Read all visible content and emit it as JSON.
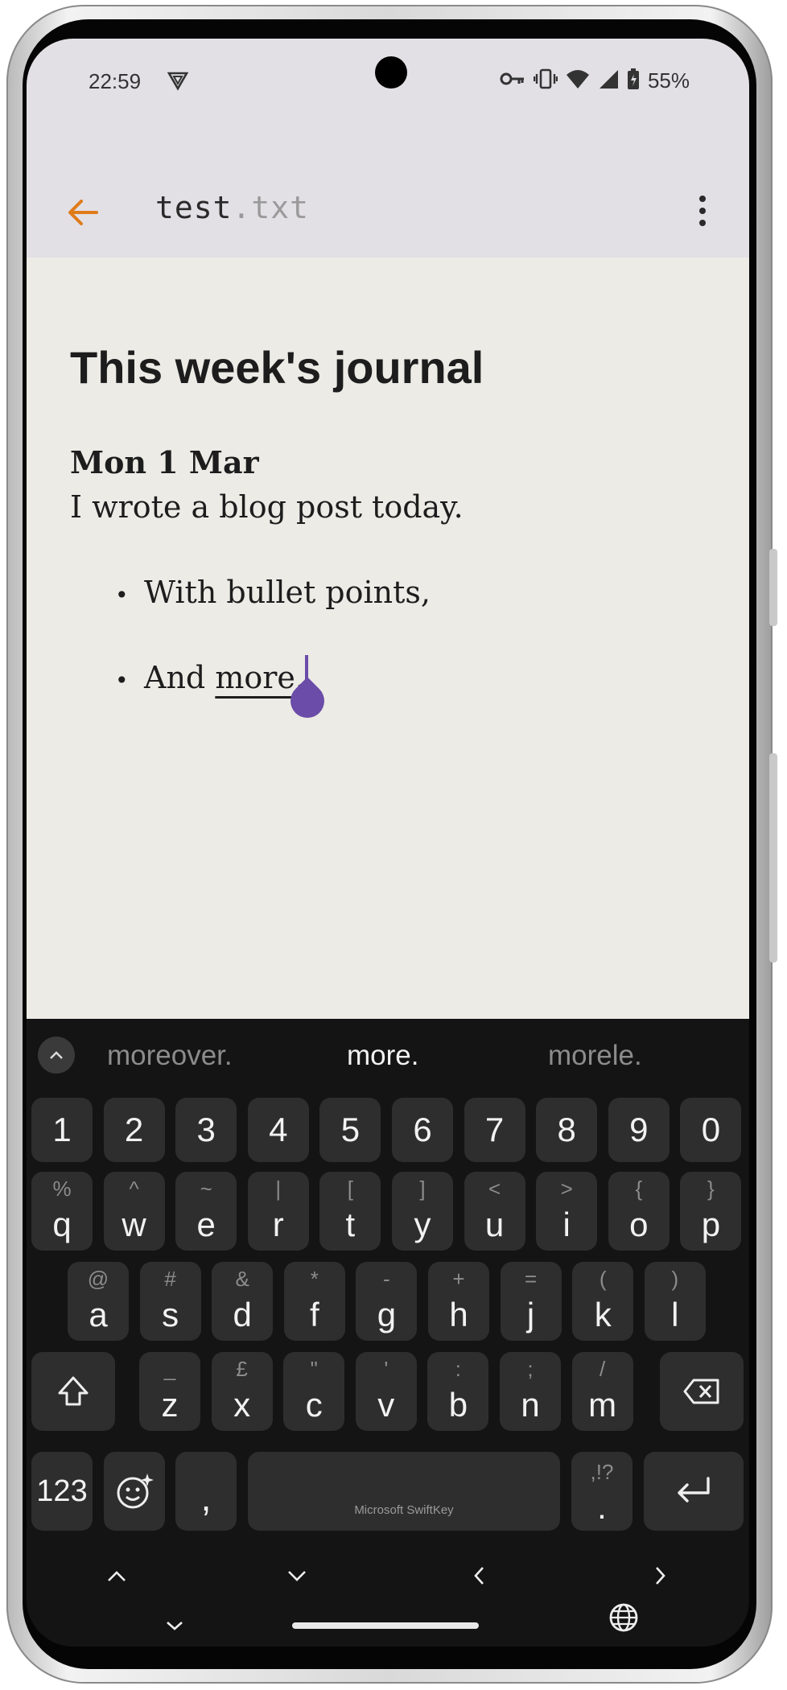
{
  "status_bar": {
    "time": "22:59",
    "battery": "55%",
    "icons": [
      "vpn-icon",
      "key-icon",
      "vibrate-icon",
      "wifi-icon",
      "signal-icon",
      "battery-icon"
    ]
  },
  "app_bar": {
    "file_name": "test",
    "file_ext": ".txt",
    "back_icon": "arrow-back-icon",
    "menu_icon": "more-vert-icon",
    "accent_color": "#e07b1a"
  },
  "document": {
    "heading": "This week's journal",
    "date": "Mon 1 Mar",
    "body": "I wrote a blog post today.",
    "bullets": [
      {
        "text": "With bullet points,"
      },
      {
        "prefix": "And ",
        "underlined": "more."
      }
    ],
    "cursor_color": "#6b4ca8"
  },
  "keyboard": {
    "suggestions": [
      "moreover.",
      "more.",
      "morele."
    ],
    "number_row": [
      "1",
      "2",
      "3",
      "4",
      "5",
      "6",
      "7",
      "8",
      "9",
      "0"
    ],
    "row1": [
      {
        "k": "q",
        "s": "%"
      },
      {
        "k": "w",
        "s": "^"
      },
      {
        "k": "e",
        "s": "~"
      },
      {
        "k": "r",
        "s": "|"
      },
      {
        "k": "t",
        "s": "["
      },
      {
        "k": "y",
        "s": "]"
      },
      {
        "k": "u",
        "s": "<"
      },
      {
        "k": "i",
        "s": ">"
      },
      {
        "k": "o",
        "s": "{"
      },
      {
        "k": "p",
        "s": "}"
      }
    ],
    "row2": [
      {
        "k": "a",
        "s": "@"
      },
      {
        "k": "s",
        "s": "#"
      },
      {
        "k": "d",
        "s": "&"
      },
      {
        "k": "f",
        "s": "*"
      },
      {
        "k": "g",
        "s": "-"
      },
      {
        "k": "h",
        "s": "+"
      },
      {
        "k": "j",
        "s": "="
      },
      {
        "k": "k",
        "s": "("
      },
      {
        "k": "l",
        "s": ")"
      }
    ],
    "row3": [
      {
        "k": "z",
        "s": "_"
      },
      {
        "k": "x",
        "s": "£"
      },
      {
        "k": "c",
        "s": "\""
      },
      {
        "k": "v",
        "s": "'"
      },
      {
        "k": "b",
        "s": ":"
      },
      {
        "k": "n",
        "s": ";"
      },
      {
        "k": "m",
        "s": "/"
      }
    ],
    "symbols_key": "123",
    "comma": ",",
    "space_label": "Microsoft SwiftKey",
    "period_key": ".",
    "period_alt": ",!?"
  }
}
